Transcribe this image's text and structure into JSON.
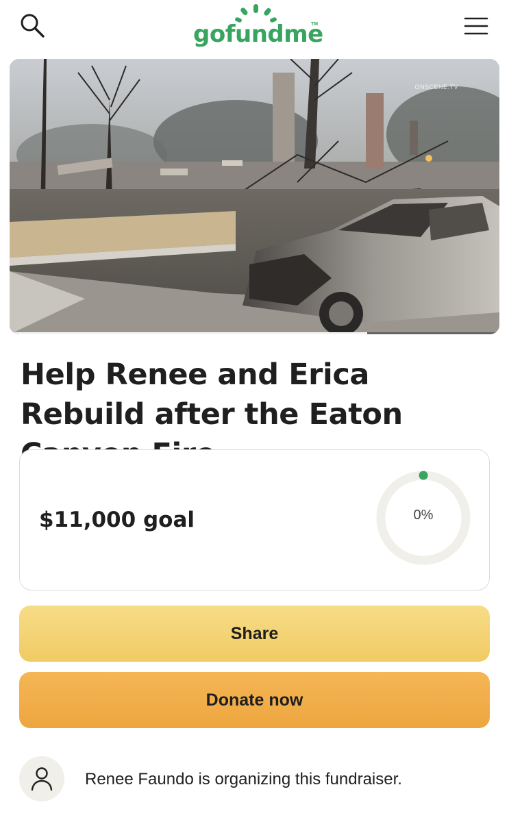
{
  "header": {
    "logo_text": "gofundme",
    "logo_tm": "TM",
    "search_icon": "search-icon",
    "menu_icon": "hamburger-menu-icon",
    "brand_color": "#37a560"
  },
  "hero": {
    "watermark": "ONSCENE.TV",
    "playback_progress": 0.73
  },
  "campaign": {
    "title": "Help Renee and Erica Rebuild after the Eaton Canyon Fire",
    "goal_text": "$11,000 goal",
    "progress_label": "0%",
    "progress_value": 0
  },
  "actions": {
    "share_label": "Share",
    "donate_label": "Donate now",
    "share_color": "#f0cb63",
    "donate_color": "#eda63f"
  },
  "organizer": {
    "text": "Renee Faundo is organizing this fundraiser.",
    "avatar_icon": "person-icon"
  }
}
